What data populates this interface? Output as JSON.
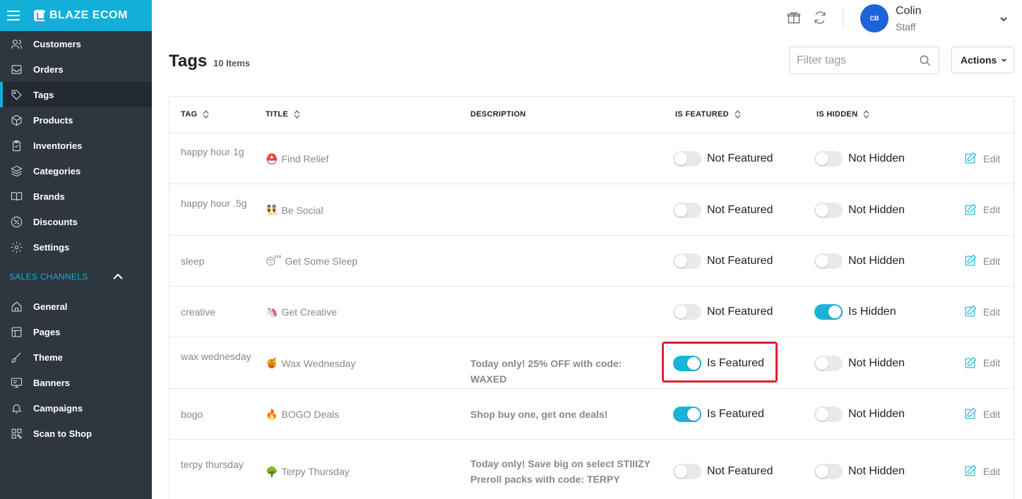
{
  "brand": {
    "name": "BLAZE ECOM"
  },
  "sidebar": {
    "items": [
      {
        "label": "Customers",
        "icon": "users-icon"
      },
      {
        "label": "Orders",
        "icon": "inbox-icon"
      },
      {
        "label": "Tags",
        "icon": "tag-icon",
        "active": true
      },
      {
        "label": "Products",
        "icon": "box-icon"
      },
      {
        "label": "Inventories",
        "icon": "clipboard-icon"
      },
      {
        "label": "Categories",
        "icon": "layers-icon"
      },
      {
        "label": "Brands",
        "icon": "book-icon"
      },
      {
        "label": "Discounts",
        "icon": "percent-icon"
      },
      {
        "label": "Settings",
        "icon": "gear-icon"
      }
    ],
    "section_label": "SALES CHANNELS",
    "channel_items": [
      {
        "label": "General",
        "icon": "home-icon"
      },
      {
        "label": "Pages",
        "icon": "layout-icon"
      },
      {
        "label": "Theme",
        "icon": "brush-icon"
      },
      {
        "label": "Banners",
        "icon": "monitor-icon"
      },
      {
        "label": "Campaigns",
        "icon": "bell-icon"
      },
      {
        "label": "Scan to Shop",
        "icon": "qr-icon"
      }
    ]
  },
  "header": {
    "user": {
      "initials": "CB",
      "name": "Colin",
      "role": "Staff"
    }
  },
  "page": {
    "title": "Tags",
    "count": "10 Items",
    "filter_placeholder": "Filter tags",
    "actions_label": "Actions"
  },
  "table": {
    "headers": {
      "tag": "TAG",
      "title": "TITLE",
      "description": "DESCRIPTION",
      "featured": "IS FEATURED",
      "hidden": "IS HIDDEN"
    },
    "edit_label": "Edit",
    "rows": [
      {
        "tag": "happy hour 1g",
        "emoji": "⛑️",
        "title": "Find Relief",
        "description": "",
        "featured": false,
        "featured_label": "Not Featured",
        "hidden": false,
        "hidden_label": "Not Hidden"
      },
      {
        "tag": "happy hour .5g",
        "emoji": "👯",
        "title": "Be Social",
        "description": "",
        "featured": false,
        "featured_label": "Not Featured",
        "hidden": false,
        "hidden_label": "Not Hidden"
      },
      {
        "tag": "sleep",
        "emoji": "😴",
        "title": "Get Some Sleep",
        "description": "",
        "featured": false,
        "featured_label": "Not Featured",
        "hidden": false,
        "hidden_label": "Not Hidden"
      },
      {
        "tag": "creative",
        "emoji": "🦄",
        "title": "Get Creative",
        "description": "",
        "featured": false,
        "featured_label": "Not Featured",
        "hidden": true,
        "hidden_label": "Is Hidden"
      },
      {
        "tag": "wax wednesday",
        "emoji": "🍯",
        "title": "Wax Wednesday",
        "description": "Today only! 25% OFF with code: WAXED",
        "featured": true,
        "featured_label": "Is Featured",
        "hidden": false,
        "hidden_label": "Not Hidden"
      },
      {
        "tag": "bogo",
        "emoji": "🔥",
        "title": "BOGO Deals",
        "description": "Shop buy one, get one deals!",
        "featured": true,
        "featured_label": "Is Featured",
        "hidden": false,
        "hidden_label": "Not Hidden"
      },
      {
        "tag": "terpy thursday",
        "emoji": "🌳",
        "title": "Terpy Thursday",
        "description": "Today only! Save big on select STIIIZY Preroll packs with code: TERPY",
        "featured": false,
        "featured_label": "Not Featured",
        "hidden": false,
        "hidden_label": "Not Hidden"
      }
    ]
  },
  "colors": {
    "accent": "#12b0d9",
    "sidebar_bg": "#2e3640",
    "avatar": "#1f63d6",
    "highlight": "#e0202e"
  }
}
